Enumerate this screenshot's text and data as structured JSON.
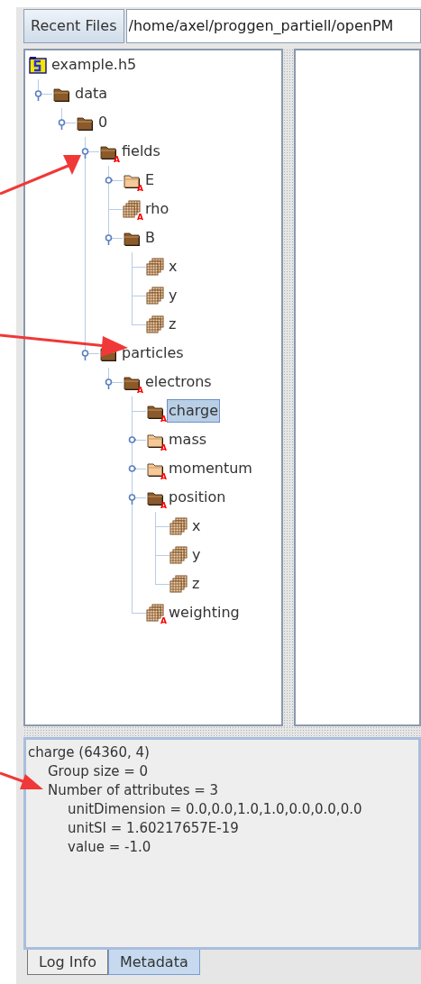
{
  "toolbar": {
    "recent_button": "Recent Files",
    "path": "/home/axel/proggen_partiell/openPM"
  },
  "tree": {
    "label": "example.h5",
    "kind": "file",
    "children": [
      {
        "label": "data",
        "kind": "group",
        "expanded": true,
        "children": [
          {
            "label": "0",
            "kind": "group",
            "expanded": true,
            "children": [
              {
                "label": "fields",
                "kind": "group",
                "badge": "A",
                "expanded": true,
                "children": [
                  {
                    "label": "E",
                    "kind": "group",
                    "badge": "A",
                    "expanded": false
                  },
                  {
                    "label": "rho",
                    "kind": "dataset",
                    "badge": "A"
                  },
                  {
                    "label": "B",
                    "kind": "group",
                    "expanded": true,
                    "children": [
                      {
                        "label": "x",
                        "kind": "dataset"
                      },
                      {
                        "label": "y",
                        "kind": "dataset"
                      },
                      {
                        "label": "z",
                        "kind": "dataset"
                      }
                    ]
                  }
                ]
              },
              {
                "label": "particles",
                "kind": "group",
                "expanded": true,
                "children": [
                  {
                    "label": "electrons",
                    "kind": "group",
                    "badge": "A",
                    "expanded": true,
                    "children": [
                      {
                        "label": "charge",
                        "kind": "group",
                        "badge": "A",
                        "selected": true
                      },
                      {
                        "label": "mass",
                        "kind": "group",
                        "badge": "A",
                        "expanded": false,
                        "selected": false
                      },
                      {
                        "label": "momentum",
                        "kind": "group",
                        "badge": "A",
                        "expanded": false,
                        "selected": false
                      },
                      {
                        "label": "position",
                        "kind": "group",
                        "badge": "A",
                        "expanded": true,
                        "selected": false,
                        "children": [
                          {
                            "label": "x",
                            "kind": "dataset"
                          },
                          {
                            "label": "y",
                            "kind": "dataset"
                          },
                          {
                            "label": "z",
                            "kind": "dataset"
                          }
                        ]
                      },
                      {
                        "label": "weighting",
                        "kind": "dataset",
                        "badge": "A",
                        "selected": false
                      }
                    ]
                  }
                ]
              }
            ]
          }
        ]
      }
    ]
  },
  "metadata": [
    {
      "kind": "header",
      "text": "charge (64360, 4)"
    },
    {
      "kind": "property",
      "text": "Group size = 0"
    },
    {
      "kind": "property",
      "text": "Number of attributes = 3"
    },
    {
      "kind": "attribute",
      "text": "unitDimension = 0.0,0.0,1.0,1.0,0.0,0.0,0.0"
    },
    {
      "kind": "attribute",
      "text": "unitSI = 1.60217657E-19"
    },
    {
      "kind": "attribute",
      "text": "value = -1.0"
    }
  ],
  "tabs": [
    {
      "label": "Log Info",
      "selected": false
    },
    {
      "label": "Metadata",
      "selected": true
    }
  ]
}
